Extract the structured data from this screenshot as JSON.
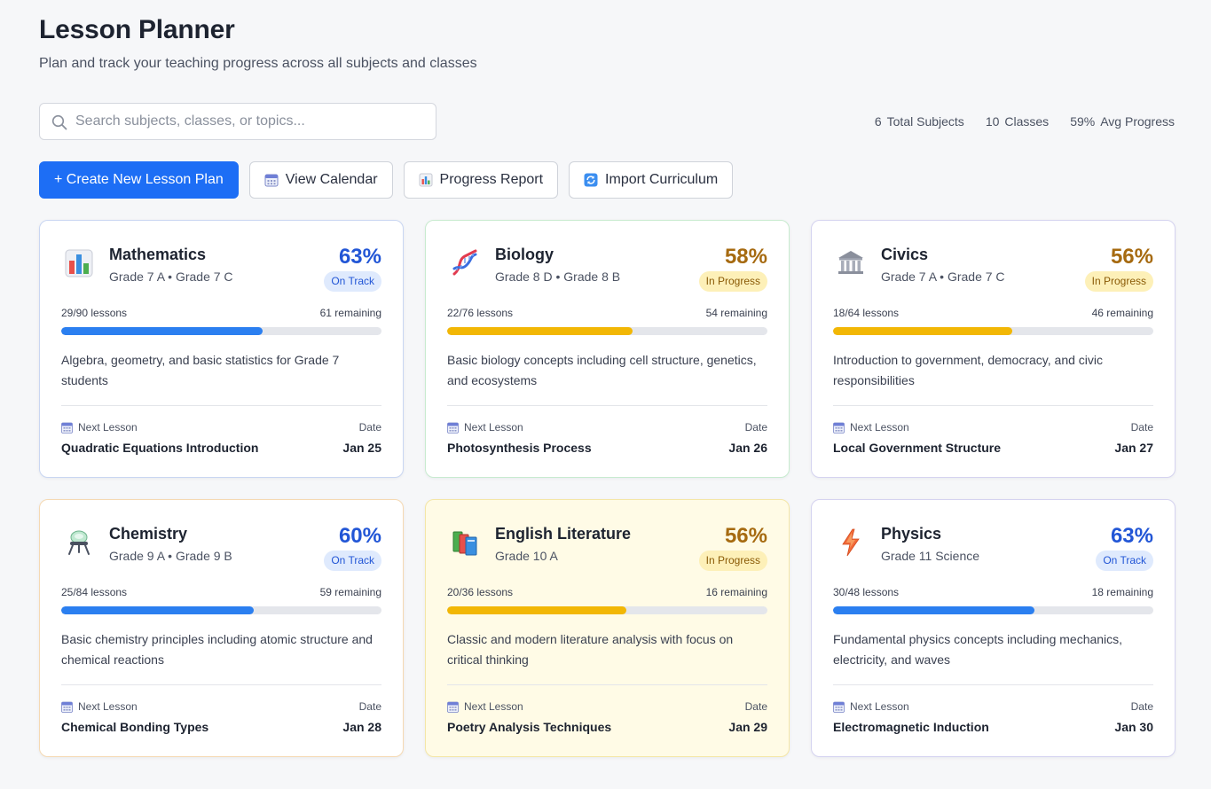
{
  "header": {
    "title": "Lesson Planner",
    "subtitle": "Plan and track your teaching progress across all subjects and classes"
  },
  "search": {
    "placeholder": "Search subjects, classes, or topics...",
    "value": ""
  },
  "stats": [
    {
      "value": "6",
      "label": "Total Subjects"
    },
    {
      "value": "10",
      "label": "Classes"
    },
    {
      "value": "59%",
      "label": "Avg Progress"
    }
  ],
  "actions": {
    "create": "+ Create New Lesson Plan",
    "calendar": "View Calendar",
    "report": "Progress Report",
    "import": "Import Curriculum"
  },
  "colors": {
    "primary": "#1d6ef5",
    "on_track": "#2256d6",
    "in_progress": "#a66a10",
    "bar_blue": "#2b7ff0",
    "bar_amber": "#f2b705"
  },
  "subjects": [
    {
      "icon": "bar-chart-icon",
      "name": "Mathematics",
      "classes": "Grade 7 A • Grade 7 C",
      "percent": "63%",
      "progress": 0.63,
      "status": "On Track",
      "lessons": "29/90 lessons",
      "remaining": "61 remaining",
      "description": "Algebra, geometry, and basic statistics for Grade 7 students",
      "next_label": "Next Lesson",
      "date_label": "Date",
      "next_lesson": "Quadratic Equations Introduction",
      "date": "Jan 25"
    },
    {
      "icon": "dna-icon",
      "name": "Biology",
      "classes": "Grade 8 D • Grade 8 B",
      "percent": "58%",
      "progress": 0.58,
      "status": "In Progress",
      "lessons": "22/76 lessons",
      "remaining": "54 remaining",
      "description": "Basic biology concepts including cell structure, genetics, and ecosystems",
      "next_label": "Next Lesson",
      "date_label": "Date",
      "next_lesson": "Photosynthesis Process",
      "date": "Jan 26"
    },
    {
      "icon": "government-building-icon",
      "name": "Civics",
      "classes": "Grade 7 A • Grade 7 C",
      "percent": "56%",
      "progress": 0.56,
      "status": "In Progress",
      "lessons": "18/64 lessons",
      "remaining": "46 remaining",
      "description": "Introduction to government, democracy, and civic responsibilities",
      "next_label": "Next Lesson",
      "date_label": "Date",
      "next_lesson": "Local Government Structure",
      "date": "Jan 27"
    },
    {
      "icon": "test-tube-icon",
      "name": "Chemistry",
      "classes": "Grade 9 A • Grade 9 B",
      "percent": "60%",
      "progress": 0.6,
      "status": "On Track",
      "lessons": "25/84 lessons",
      "remaining": "59 remaining",
      "description": "Basic chemistry principles including atomic structure and chemical reactions",
      "next_label": "Next Lesson",
      "date_label": "Date",
      "next_lesson": "Chemical Bonding Types",
      "date": "Jan 28"
    },
    {
      "icon": "books-icon",
      "name": "English Literature",
      "classes": "Grade 10 A",
      "percent": "56%",
      "progress": 0.56,
      "status": "In Progress",
      "lessons": "20/36 lessons",
      "remaining": "16 remaining",
      "description": "Classic and modern literature analysis with focus on critical thinking",
      "next_label": "Next Lesson",
      "date_label": "Date",
      "next_lesson": "Poetry Analysis Techniques",
      "date": "Jan 29"
    },
    {
      "icon": "lightning-icon",
      "name": "Physics",
      "classes": "Grade 11 Science",
      "percent": "63%",
      "progress": 0.63,
      "status": "On Track",
      "lessons": "30/48 lessons",
      "remaining": "18 remaining",
      "description": "Fundamental physics concepts including mechanics, electricity, and waves",
      "next_label": "Next Lesson",
      "date_label": "Date",
      "next_lesson": "Electromagnetic Induction",
      "date": "Jan 30"
    }
  ]
}
